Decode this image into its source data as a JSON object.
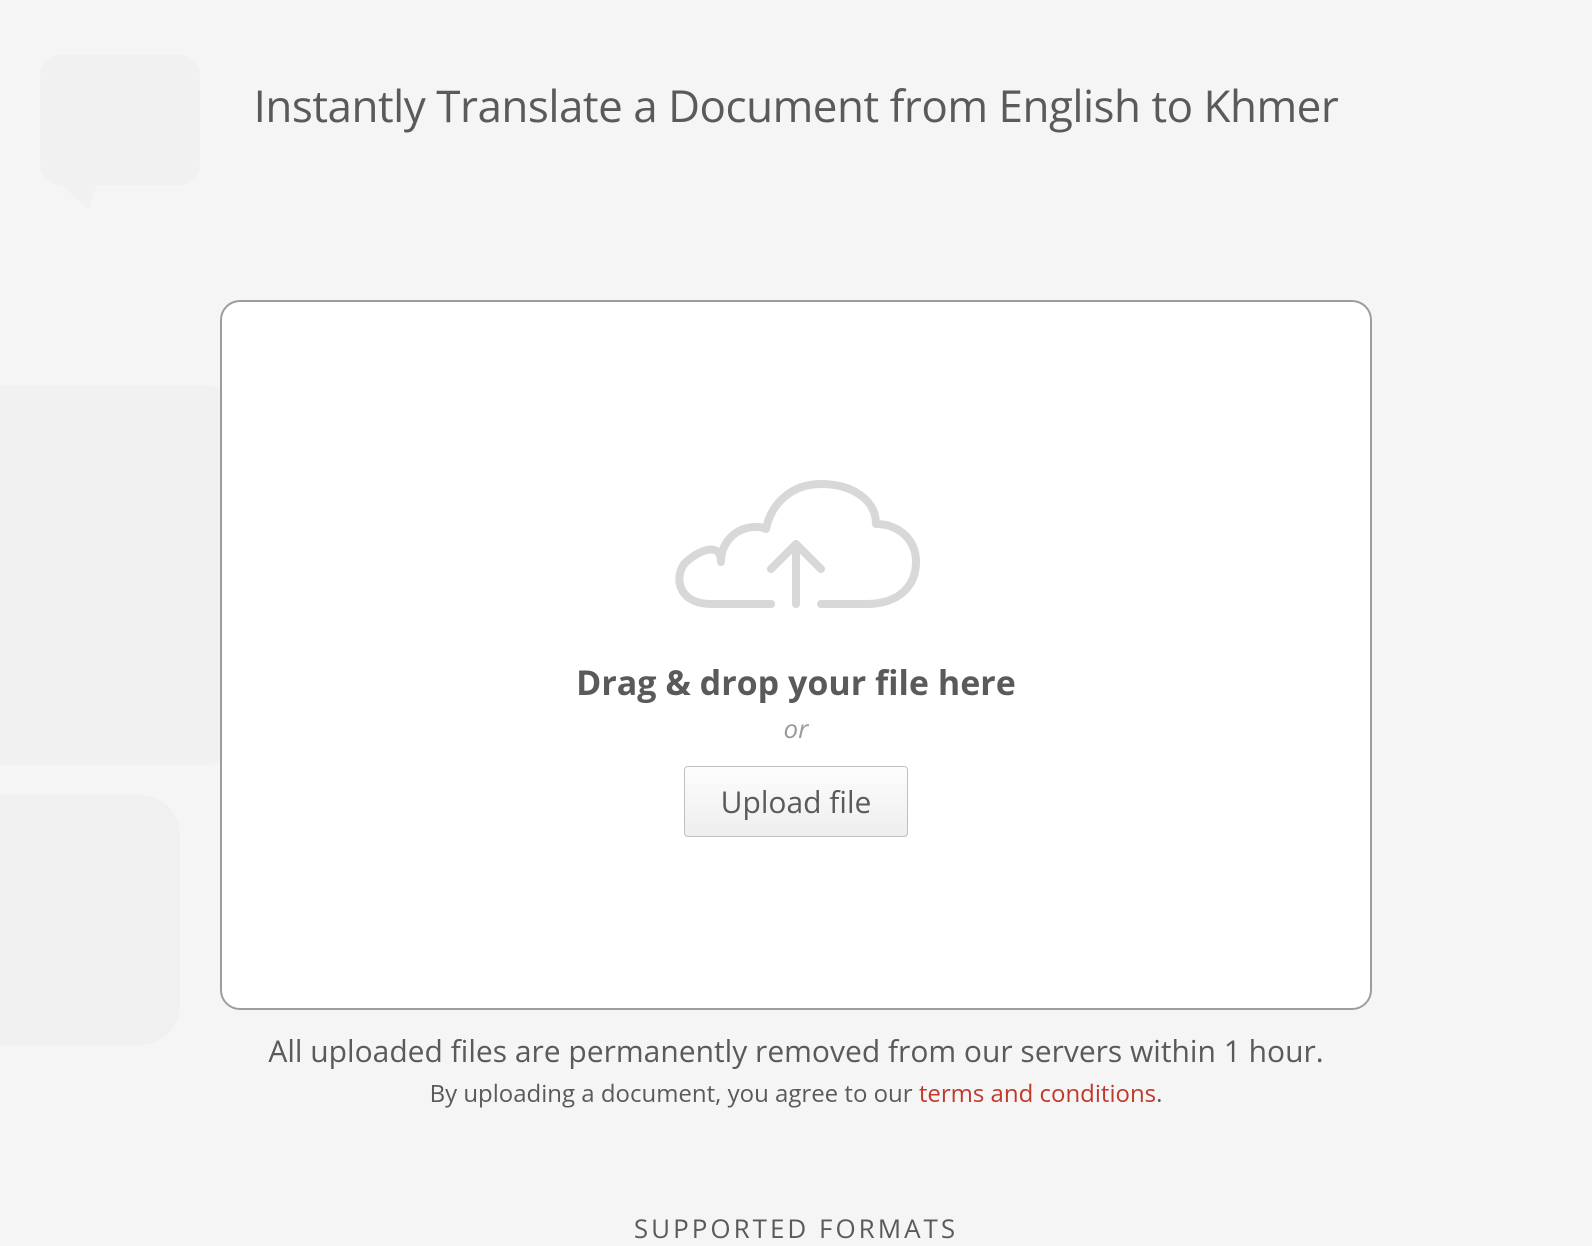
{
  "header": {
    "title": "Instantly Translate a Document from English to Khmer"
  },
  "upload": {
    "drag_text": "Drag & drop your file here",
    "or_text": "or",
    "button_label": "Upload file"
  },
  "notices": {
    "removal_text": "All uploaded files are permanently removed from our servers within 1 hour.",
    "agreement_prefix": "By uploading a document, you agree to our ",
    "terms_link_text": "terms and conditions",
    "agreement_suffix": "."
  },
  "footer": {
    "supported_formats_label": "SUPPORTED FORMATS"
  }
}
